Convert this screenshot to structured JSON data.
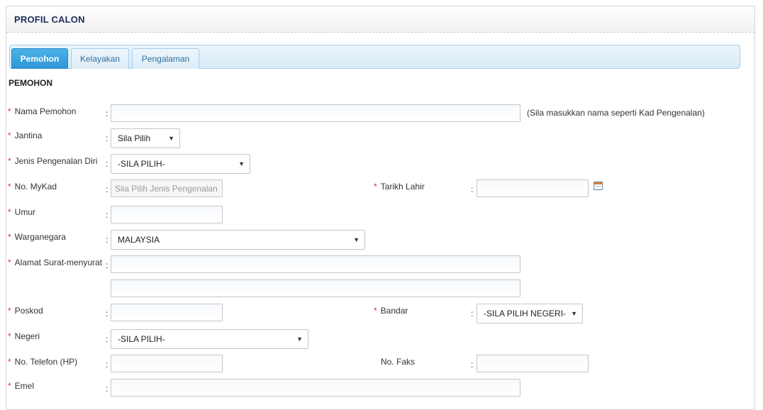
{
  "header": {
    "title": "PROFIL CALON"
  },
  "tabs": [
    {
      "label": "Pemohon",
      "active": true
    },
    {
      "label": "Kelayakan",
      "active": false
    },
    {
      "label": "Pengalaman",
      "active": false
    }
  ],
  "section": {
    "title": "PEMOHON"
  },
  "form": {
    "nama": {
      "label": "Nama Pemohon",
      "required": true,
      "value": "",
      "hint": "(Sila masukkan nama seperti Kad Pengenalan)"
    },
    "jantina": {
      "label": "Jantina",
      "required": true,
      "selected": "Sila Pilih"
    },
    "jenis_pengenalan": {
      "label": "Jenis Pengenalan Diri",
      "required": true,
      "selected": "-SILA PILIH-"
    },
    "mykad": {
      "label": "No. MyKad",
      "required": true,
      "value": "",
      "placeholder": "Sila Pilih Jenis Pengenalan Diri"
    },
    "tarikh_lahir": {
      "label": "Tarikh Lahir",
      "required": true,
      "value": ""
    },
    "umur": {
      "label": "Umur",
      "required": true,
      "value": ""
    },
    "warganegara": {
      "label": "Warganegara",
      "required": true,
      "selected": "MALAYSIA"
    },
    "alamat": {
      "label": "Alamat Surat-menyurat",
      "required": true,
      "line1": "",
      "line2": ""
    },
    "poskod": {
      "label": "Poskod",
      "required": true,
      "value": ""
    },
    "bandar": {
      "label": "Bandar",
      "required": true,
      "selected": "-SILA PILIH NEGERI-"
    },
    "negeri": {
      "label": "Negeri",
      "required": true,
      "selected": "-SILA PILIH-"
    },
    "telefon": {
      "label": "No. Telefon (HP)",
      "required": true,
      "value": ""
    },
    "faks": {
      "label": "No. Faks",
      "required": false,
      "value": ""
    },
    "emel": {
      "label": "Emel",
      "required": true,
      "value": ""
    }
  },
  "colon": ":",
  "required_marker": "*",
  "icons": {
    "calendar": "calendar-icon",
    "dropdown": "chevron-down-icon"
  },
  "colors": {
    "tab_active": "#2d95d6",
    "title": "#1f2d5a",
    "required": "#dd3333"
  }
}
